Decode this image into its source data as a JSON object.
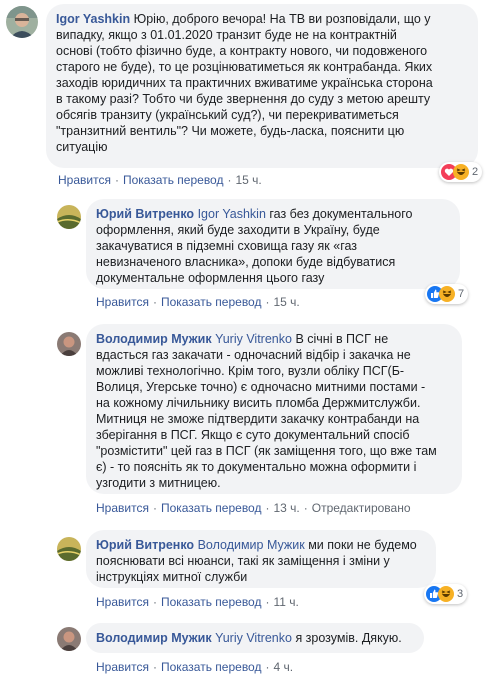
{
  "colors": {
    "link": "#385898",
    "bubble": "#f2f3f5",
    "meta": "#606770",
    "like_blue": "#1877f2",
    "haha_yellow": "#f7b125",
    "love_red": "#f33e58"
  },
  "comments": [
    {
      "author": "Igor Yashkin",
      "mention": "",
      "text": " Юрію, доброго вечора! На ТВ ви розповідали, що у\nвипадку, якщо з 01.01.2020 транзит буде не на контрактній\nоснові (тобто фізично буде, а контракту нового, чи подовженого\nстарого не буде), то це розцінюватиметься як контрабанда. Яких\nзаходів юридичних та практичних вживатиме українська сторона\nв такому разі? Тобто чи буде звернення до суду з метою арешту\nобсягів транзиту (український суд?), чи перекриватиметься\n\"транзитний вентиль\"? Чи можете, будь-ласка, пояснити цю\nситуацію",
      "like": "Нравится",
      "translate": "Показать перевод",
      "time": "15 ч.",
      "edited": "",
      "reaction_count": "2",
      "reactions": [
        "love-icon",
        "haha-icon"
      ]
    },
    {
      "author": "Юрий Витренко",
      "mention": "Igor Yashkin",
      "text": " газ без документального\nоформлення, який буде заходити в Україну, буде\nзакачуватися в підземні сховища газу як «газ\nневизначеного власника», допоки буде відбуватися\nдокументальне оформлення цього газу",
      "like": "Нравится",
      "translate": "Показать перевод",
      "time": "15 ч.",
      "edited": "",
      "reaction_count": "7",
      "reactions": [
        "like-icon",
        "haha-icon"
      ]
    },
    {
      "author": "Володимир Мужик",
      "mention": "Yuriy Vitrenko",
      "text": " В січні в ПСГ не\nвдасться газ закачати - одночасний відбір і закачка не\nможливі технологічно. Крім того, вузли обліку ПСГ(Б-\nВолиця, Угерське точно) є одночасно митними постами -\nна кожному лічильнику висить пломба Держмитслужби.\nМитниця не зможе підтвердити закачку контрабанди на\nзберігання в ПСГ. Якщо є суто документальний спосіб\n\"розмістити\" цей газ в ПСГ (як заміщення того, що вже там\nє) - то поясніть як то документально можна оформити і\nузгодити з митницею.",
      "like": "Нравится",
      "translate": "Показать перевод",
      "time": "13 ч.",
      "edited": "Отредактировано",
      "reaction_count": "",
      "reactions": []
    },
    {
      "author": "Юрий Витренко",
      "mention": "Володимир Мужик",
      "text": " ми поки не будемо\nпояснювати всі нюанси, такі як заміщення і зміни у\nінструкціях митної служби",
      "like": "Нравится",
      "translate": "Показать перевод",
      "time": "11 ч.",
      "edited": "",
      "reaction_count": "3",
      "reactions": [
        "like-icon",
        "haha-icon"
      ]
    },
    {
      "author": "Володимир Мужик",
      "mention": "Yuriy Vitrenko",
      "text": " я зрозумів. Дякую.",
      "like": "Нравится",
      "translate": "Показать перевод",
      "time": "4 ч.",
      "edited": "",
      "reaction_count": "",
      "reactions": []
    }
  ]
}
